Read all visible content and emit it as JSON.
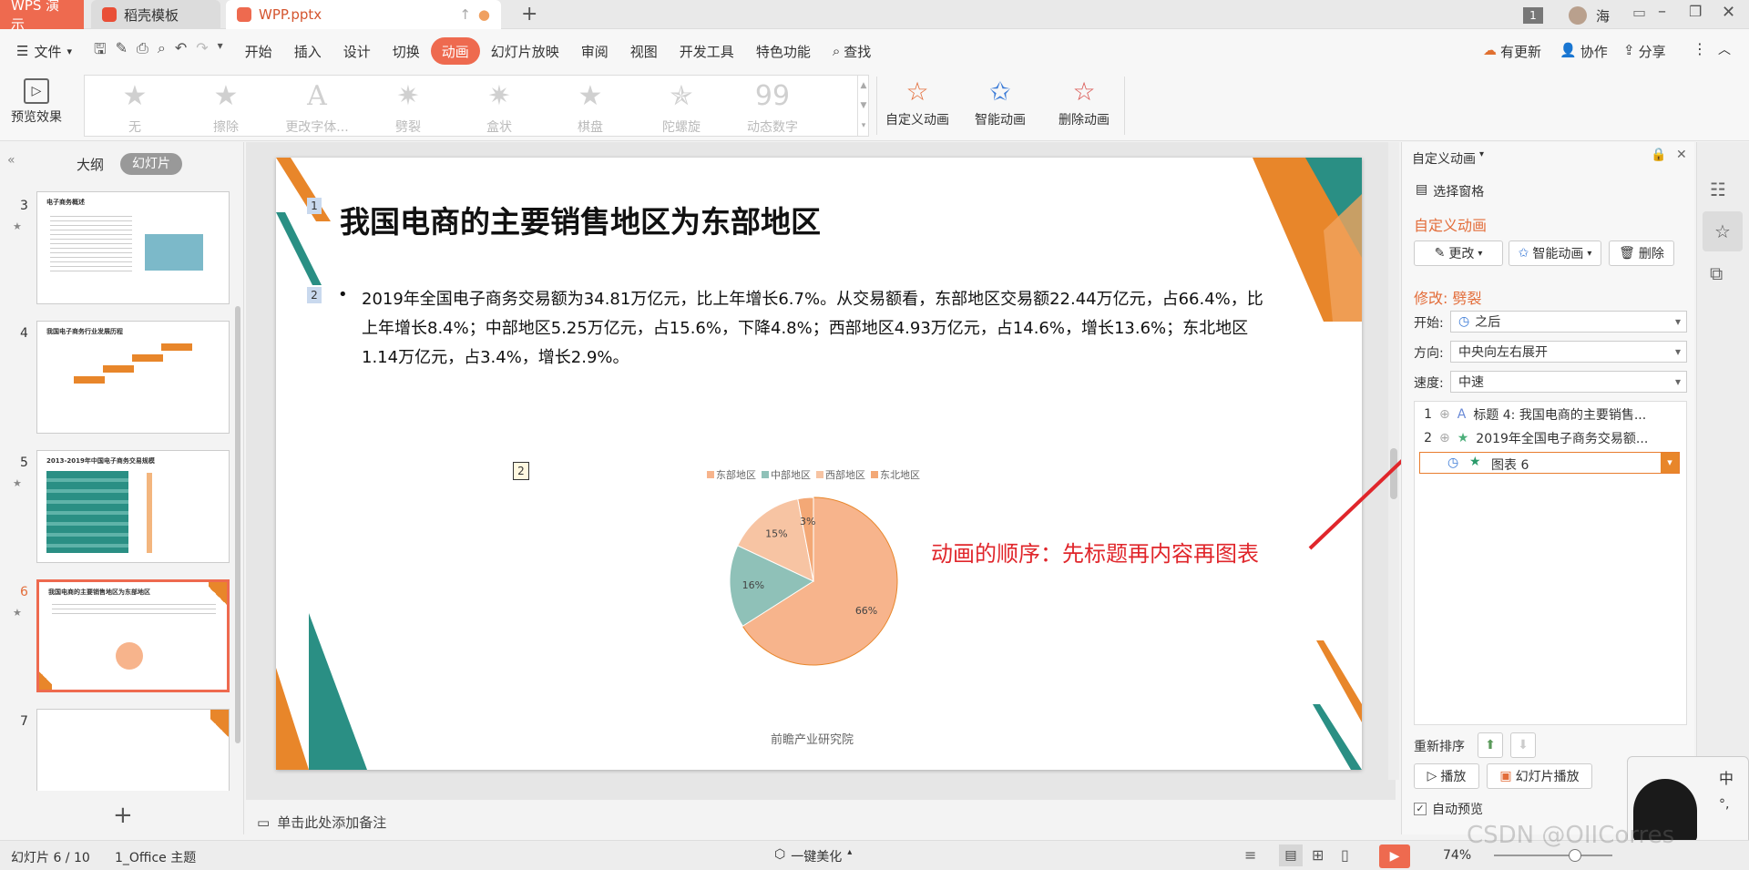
{
  "tabs": {
    "app": "WPS 演示",
    "docer": "稻壳模板",
    "file": "WPP.pptx"
  },
  "titlebar": {
    "page_count": "1",
    "user": "海"
  },
  "menu": {
    "file": "文件",
    "items": [
      "开始",
      "插入",
      "设计",
      "切换",
      "动画",
      "幻灯片放映",
      "审阅",
      "视图",
      "开发工具",
      "特色功能"
    ],
    "active_index": 4,
    "search": "查找",
    "update": "有更新",
    "collab": "协作",
    "share": "分享"
  },
  "ribbon": {
    "preview": "预览效果",
    "effects": [
      "无",
      "擦除",
      "更改字体...",
      "劈裂",
      "盒状",
      "棋盘",
      "陀螺旋",
      "动态数字"
    ],
    "custom": "自定义动画",
    "smart": "智能动画",
    "delete": "删除动画"
  },
  "left_panel": {
    "tab_outline": "大纲",
    "tab_slides": "幻灯片",
    "slide_numbers": [
      "3",
      "4",
      "5",
      "6",
      "7"
    ],
    "thumb_titles": [
      "电子商务概述",
      "我国电子商务行业发展历程",
      "2013-2019年中国电子商务交易规模",
      "我国电商的主要销售地区为东部地区",
      ""
    ],
    "add": "+"
  },
  "slide": {
    "marker1": "1",
    "marker2": "2",
    "chart_marker": "2",
    "title": "我国电商的主要销售地区为东部地区",
    "bullet": "2019年全国电子商务交易额为34.81万亿元，比上年增长6.7%。从交易额看，东部地区交易额22.44万亿元，占66.4%，比上年增长8.4%；中部地区5.25万亿元，占15.6%，下降4.8%；西部地区4.93万亿元，占14.6%，增长13.6%；东北地区1.14万亿元，占3.4%，增长2.9%。",
    "source": "前瞻产业研究院",
    "annotation": "动画的顺序：先标题再内容再图表"
  },
  "chart_data": {
    "type": "pie",
    "categories": [
      "东部地区",
      "中部地区",
      "西部地区",
      "东北地区"
    ],
    "values": [
      66,
      16,
      15,
      3
    ],
    "labels": [
      "66%",
      "16%",
      "15%",
      "3%"
    ],
    "colors": [
      "#f7b48c",
      "#8fc1b8",
      "#f7c4a3",
      "#f3a876"
    ]
  },
  "right_panel": {
    "title": "自定义动画",
    "select_pane": "选择窗格",
    "section": "自定义动画",
    "change": "更改",
    "smart": "智能动画",
    "delete": "删除",
    "modify": "修改: 劈裂",
    "start_label": "开始:",
    "start_value": "之后",
    "direction_label": "方向:",
    "direction_value": "中央向左右展开",
    "speed_label": "速度:",
    "speed_value": "中速",
    "list": [
      {
        "num": "1",
        "text": "标题 4: 我国电商的主要销售..."
      },
      {
        "num": "2",
        "text": "2019年全国电子商务交易额..."
      },
      {
        "num": "",
        "text": "图表 6"
      }
    ],
    "reorder": "重新排序",
    "play": "播放",
    "slideshow": "幻灯片播放",
    "autopreview": "自动预览"
  },
  "statusbar": {
    "slide_info": "幻灯片 6 / 10",
    "theme": "1_Office 主题",
    "notes": "单击此处添加备注",
    "beautify": "一键美化",
    "zoom": "74%"
  },
  "ime": {
    "lang": "中",
    "mode": "°,"
  },
  "watermark": "CSDN @OIICorres"
}
